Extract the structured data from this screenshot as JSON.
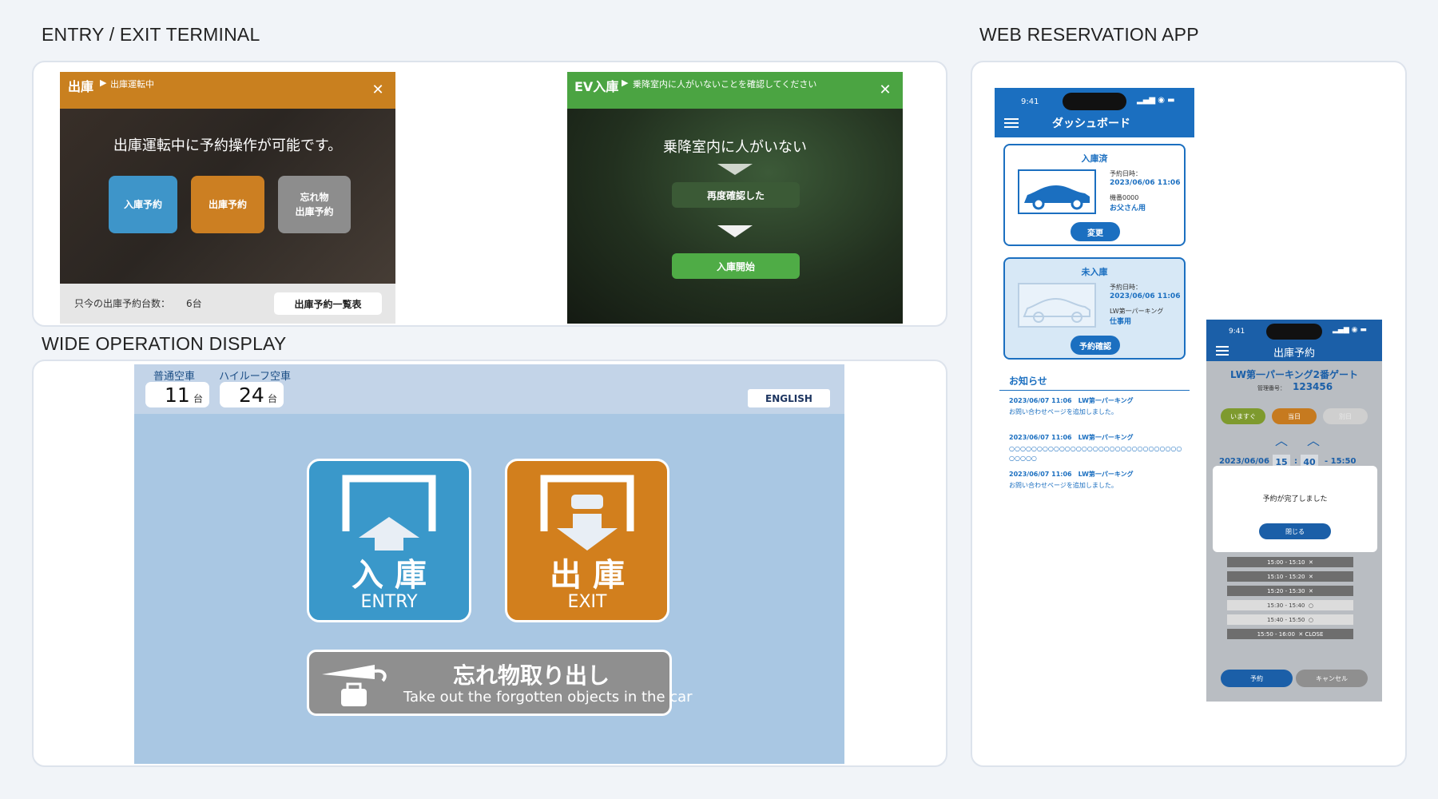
{
  "sections": {
    "terminal": "ENTRY / EXIT TERMINAL",
    "web_app": "WEB RESERVATION APP",
    "wide": "WIDE OPERATION DISPLAY"
  },
  "terminal1": {
    "title": "出庫",
    "crumb": "出庫運転中",
    "message": "出庫運転中に予約操作が可能です。",
    "btn_entry": "入庫予約",
    "btn_exit": "出庫予約",
    "btn_forgot_1": "忘れ物",
    "btn_forgot_2": "出庫予約",
    "count_label": "只今の出庫予約台数：",
    "count_value": "6台",
    "list_button": "出庫予約一覧表",
    "close": "✕"
  },
  "terminal2": {
    "title": "EV入庫",
    "crumb": "乗降室内に人がいないことを確認してください",
    "message": "乗降室内に人がいない",
    "btn_recheck": "再度確認した",
    "btn_start": "入庫開始",
    "close": "✕"
  },
  "wide": {
    "normal_label": "普通空車",
    "normal_count": "11",
    "highroof_label": "ハイルーフ空車",
    "highroof_count": "24",
    "unit": "台",
    "english_button": "ENGLISH",
    "entry_jp": "入 庫",
    "entry_en": "ENTRY",
    "exit_jp": "出 庫",
    "exit_en": "EXIT",
    "forgot_jp": "忘れ物取り出し",
    "forgot_en": "Take out the forgotten objects in the car"
  },
  "phone1": {
    "time": "9:41",
    "title": "ダッシュボード",
    "card1": {
      "status": "入庫済",
      "date_label": "予約日時：",
      "date": "2023/06/06 11:06",
      "car_id": "機番0000",
      "car_use": "お父さん用",
      "button": "変更"
    },
    "card2": {
      "status": "未入庫",
      "date_label": "予約日時：",
      "date": "2023/06/06 11:06",
      "place": "LW第一パーキング",
      "use": "仕事用",
      "button": "予約確認"
    },
    "news_title": "お知らせ",
    "news": [
      {
        "head": "2023/06/07 11:06　LW第一パーキング",
        "body": "お問い合わせページを追加しました。"
      },
      {
        "head": "2023/06/07 11:06　LW第一パーキング",
        "body": "○○○○○○○○○○○○○○○○○○○○○○○○○○○○○○○○○○○○"
      },
      {
        "head": "2023/06/07 11:06　LW第一パーキング",
        "body": "お問い合わせページを追加しました。"
      }
    ]
  },
  "phone2": {
    "time": "9:41",
    "title": "出庫予約",
    "place": "LW第一パーキング2番ゲート",
    "mgmt_label": "管理番号：",
    "mgmt_no": "123456",
    "chip_now": "いますぐ",
    "chip_today": "当日",
    "chip_other": "別日",
    "date": "2023/06/06",
    "hour": "15",
    "minute": "40",
    "end": "- 15:50",
    "dialog_msg": "予約が完了しました",
    "dialog_btn": "閉じる",
    "slots": [
      {
        "t": "15:00 - 15:10",
        "m": "✕",
        "full": true
      },
      {
        "t": "15:10 - 15:20",
        "m": "✕",
        "full": true
      },
      {
        "t": "15:20 - 15:30",
        "m": "✕",
        "full": true
      },
      {
        "t": "15:30 - 15:40",
        "m": "○",
        "full": false
      },
      {
        "t": "15:40 - 15:50",
        "m": "○",
        "full": false
      },
      {
        "t": "15:50 - 16:00",
        "m": "✕ CLOSE",
        "full": true
      }
    ],
    "btn_reserve": "予約",
    "btn_cancel": "キャンセル"
  },
  "colors": {
    "orange": "#c9801f",
    "green": "#4ba442",
    "blue": "#3a98ca",
    "appblue": "#1b6fc0"
  }
}
